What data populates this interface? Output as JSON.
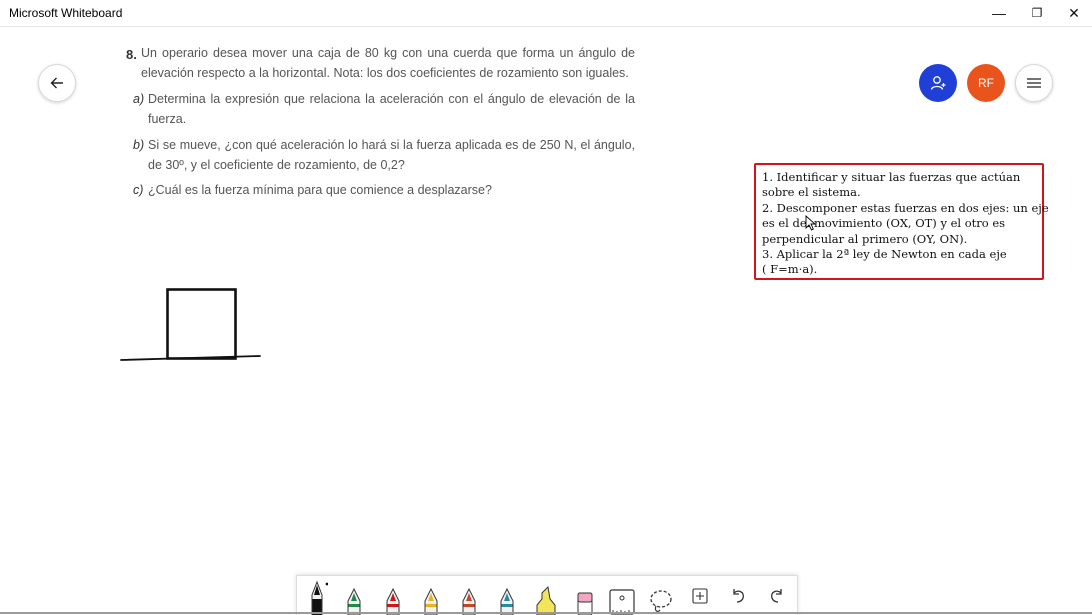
{
  "window": {
    "title": "Microsoft Whiteboard",
    "minimize_glyph": "—",
    "maximize_glyph": "❐",
    "close_glyph": "✕"
  },
  "header": {
    "avatar_initials": "RF",
    "colors": {
      "invite": "#1f3fd6",
      "avatar": "#e8541c"
    }
  },
  "problem": {
    "number": "8.",
    "statement": "Un operario desea mover una caja de 80 kg con una cuerda que forma un ángulo de elevación respecto a la horizontal. Nota: los dos coeficientes de rozamiento son iguales.",
    "items": [
      {
        "label": "a)",
        "text": "Determina la expresión que relaciona la aceleración con el ángulo de elevación de la fuerza."
      },
      {
        "label": "b)",
        "text": "Si se mueve, ¿con qué aceleración lo hará si la fuerza aplicada es de 250 N, el ángulo, de 30º, y el coeficiente de rozamiento, de 0,2?"
      },
      {
        "label": "c)",
        "text": "¿Cuál es la fuerza mínima para que comience a desplazarse?"
      }
    ]
  },
  "note": {
    "border_color": "#d3141b",
    "lines": [
      "1. Identificar y situar las fuerzas que actúan",
      "sobre el sistema.",
      "2. Descomponer estas fuerzas en dos ejes: un eje",
      "es el del movimiento (OX, OT) y el otro es",
      "perpendicular al primero (OY, ON).",
      "3. Aplicar la 2ª ley de Newton en cada eje",
      "(  F=m·a)."
    ]
  },
  "toolbar": {
    "tools": [
      {
        "name": "pen-black",
        "color": "#111111"
      },
      {
        "name": "pen-green",
        "color": "#1e8a4a"
      },
      {
        "name": "pen-red",
        "color": "#d3141b"
      },
      {
        "name": "pen-yellow",
        "color": "#e8b323"
      },
      {
        "name": "pen-rainbow",
        "color": "#c8452d"
      },
      {
        "name": "pen-galaxy",
        "color": "#2a8aa0"
      },
      {
        "name": "highlighter",
        "color": "#f2e55a"
      },
      {
        "name": "eraser",
        "color": "#f2a6c4"
      }
    ]
  }
}
